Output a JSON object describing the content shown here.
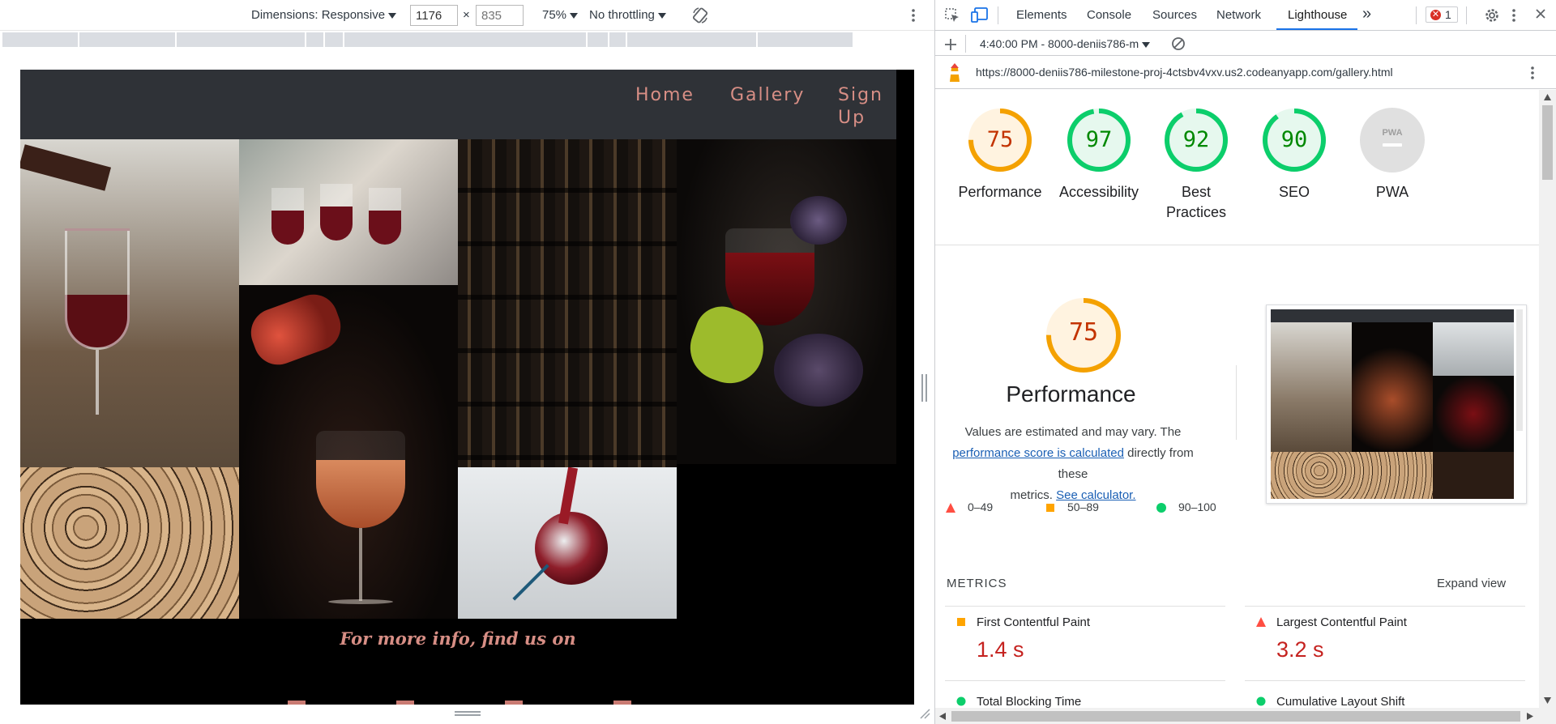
{
  "device_toolbar": {
    "dimensions_label": "Dimensions: Responsive",
    "width_value": "1176",
    "times_sign": "×",
    "height_placeholder": "835",
    "zoom": "75%",
    "throttling": "No throttling"
  },
  "site": {
    "nav": [
      "Home",
      "Gallery",
      "Sign",
      "Up"
    ],
    "tagline": "For more info, find us on"
  },
  "devtools": {
    "tabs": [
      "Elements",
      "Console",
      "Sources",
      "Network",
      "Lighthouse"
    ],
    "more_tabs": "»",
    "error_count": "1",
    "report_time": "4:40:00 PM - 8000-deniis786-m",
    "url": "https://8000-deniis786-milestone-proj-4ctsbv4vxv.us2.codeanyapp.com/gallery.html"
  },
  "lighthouse": {
    "scores": [
      {
        "label": "Performance",
        "value": 75,
        "color": "#f4a100",
        "bg": "#fff3e0",
        "text": "#c33300"
      },
      {
        "label": "Accessibility",
        "value": 97,
        "color": "#0cce6b",
        "bg": "#e6f8ee",
        "text": "#008800"
      },
      {
        "label": "Best",
        "label2": "Practices",
        "value": 92,
        "color": "#0cce6b",
        "bg": "#e6f8ee",
        "text": "#008800"
      },
      {
        "label": "SEO",
        "value": 90,
        "color": "#0cce6b",
        "bg": "#e6f8ee",
        "text": "#008800"
      },
      {
        "label": "PWA",
        "value": null,
        "badge": "PWA"
      }
    ],
    "performance": {
      "score": 75,
      "title": "Performance",
      "desc_1": "Values are estimated and may vary. The",
      "link_1": "performance score is calculated",
      "desc_2": "directly from these",
      "desc_3": "metrics.",
      "link_2": "See calculator."
    },
    "legend": [
      {
        "range": "0–49",
        "shape": "triangle",
        "color": "#ff4e42"
      },
      {
        "range": "50–89",
        "shape": "square",
        "color": "#ffa400"
      },
      {
        "range": "90–100",
        "shape": "circle",
        "color": "#0cce6b"
      }
    ],
    "metrics_heading": "METRICS",
    "expand_view": "Expand view",
    "metrics": [
      {
        "name": "First Contentful Paint",
        "value": "1.4 s",
        "status": "average"
      },
      {
        "name": "Largest Contentful Paint",
        "value": "3.2 s",
        "status": "fail"
      },
      {
        "name": "Total Blocking Time",
        "value": "",
        "status": "pass"
      },
      {
        "name": "Cumulative Layout Shift",
        "value": "",
        "status": "pass"
      }
    ]
  }
}
